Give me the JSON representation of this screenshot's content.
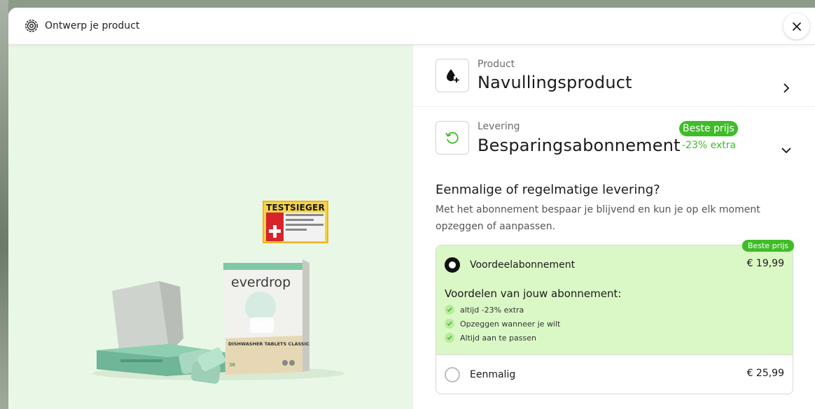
{
  "header": {
    "title": "Ontwerp je product",
    "close_icon": "close-icon",
    "icon": "gear-icon"
  },
  "product_illustration": {
    "brand": "everdrop",
    "box_text": "DISHWASHER TABLETS CLASSIC",
    "box_count": "36",
    "seal_title": "TESTSIEGER"
  },
  "product_section": {
    "label": "Product",
    "value": "Navullingsproduct",
    "icon": "drop-plus-icon"
  },
  "delivery_section": {
    "label": "Levering",
    "value": "Besparingsabonnement",
    "badge": "Beste prijs",
    "extra": "-23% extra",
    "icon": "refresh-icon"
  },
  "delivery_choice": {
    "question": "Eenmalige of regelmatige levering?",
    "description": "Met het abonnement bespaar je blijvend en kun je op elk moment opzeggen of aanpassen.",
    "options": [
      {
        "name": "Voordeelabonnement",
        "price": "€ 19,99",
        "badge": "Beste prijs",
        "selected": true,
        "benefits_title": "Voordelen van jouw abonnement:",
        "benefits": [
          "altijd -23% extra",
          "Opzeggen wanneer je wilt",
          "Altijd aan te passen"
        ]
      },
      {
        "name": "Eenmalig",
        "price": "€ 25,99",
        "selected": false
      }
    ]
  },
  "colors": {
    "accent_green": "#3fbc28",
    "left_bg": "#e9f8e6",
    "selected_option_bg": "#daf8c5"
  }
}
